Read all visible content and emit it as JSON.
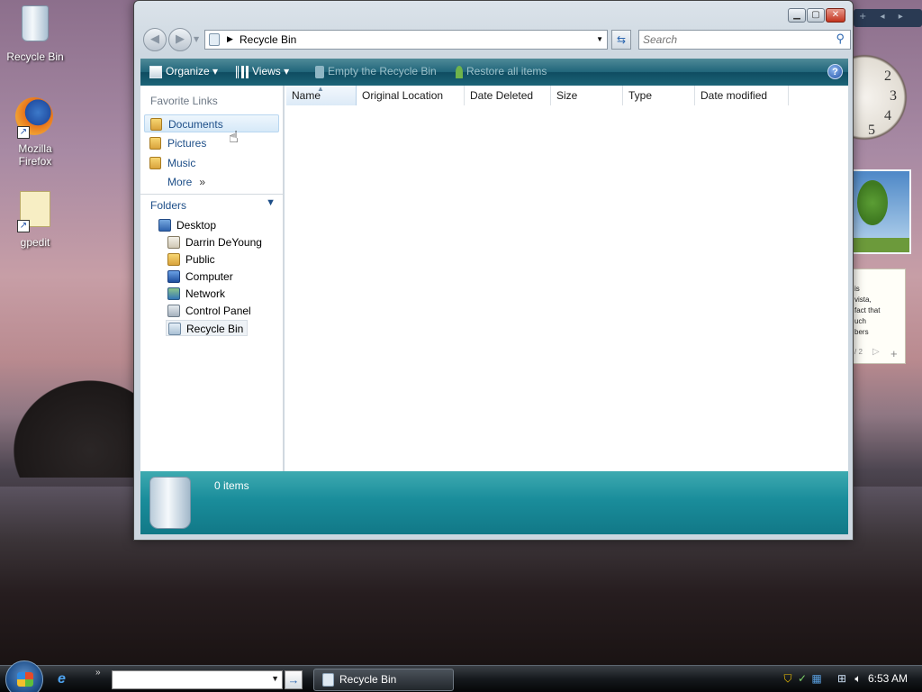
{
  "desktop": {
    "icons": [
      {
        "label": "Recycle Bin"
      },
      {
        "label": "Mozilla Firefox"
      },
      {
        "label": "gpedit"
      }
    ],
    "notes_gadget_text": "is\nvista,\nfact that\nuch\nbers",
    "notes_gadget_page": "/ 2",
    "clock_numbers": [
      "2",
      "3",
      "4",
      "5"
    ]
  },
  "window": {
    "title": "Recycle Bin",
    "address": {
      "crumb": "Recycle Bin"
    },
    "search": {
      "placeholder": "Search"
    },
    "toolbar": {
      "organize": "Organize",
      "views": "Views",
      "empty": "Empty the Recycle Bin",
      "restore": "Restore all items",
      "help": "?"
    },
    "nav": {
      "favorite_links_header": "Favorite Links",
      "favorites": [
        "Documents",
        "Pictures",
        "Music"
      ],
      "more": "More",
      "folders_header": "Folders",
      "tree": [
        "Desktop",
        "Darrin DeYoung",
        "Public",
        "Computer",
        "Network",
        "Control Panel",
        "Recycle Bin"
      ]
    },
    "columns": [
      "Name",
      "Original Location",
      "Date Deleted",
      "Size",
      "Type",
      "Date modified"
    ],
    "details": {
      "count": "0 items"
    }
  },
  "taskbar": {
    "task_button": "Recycle Bin",
    "address_value": "",
    "clock": "6:53 AM"
  },
  "colors": {
    "toolbar_accent": "#1c6578",
    "details_accent": "#1a8d9b",
    "link": "#1d4e88"
  }
}
